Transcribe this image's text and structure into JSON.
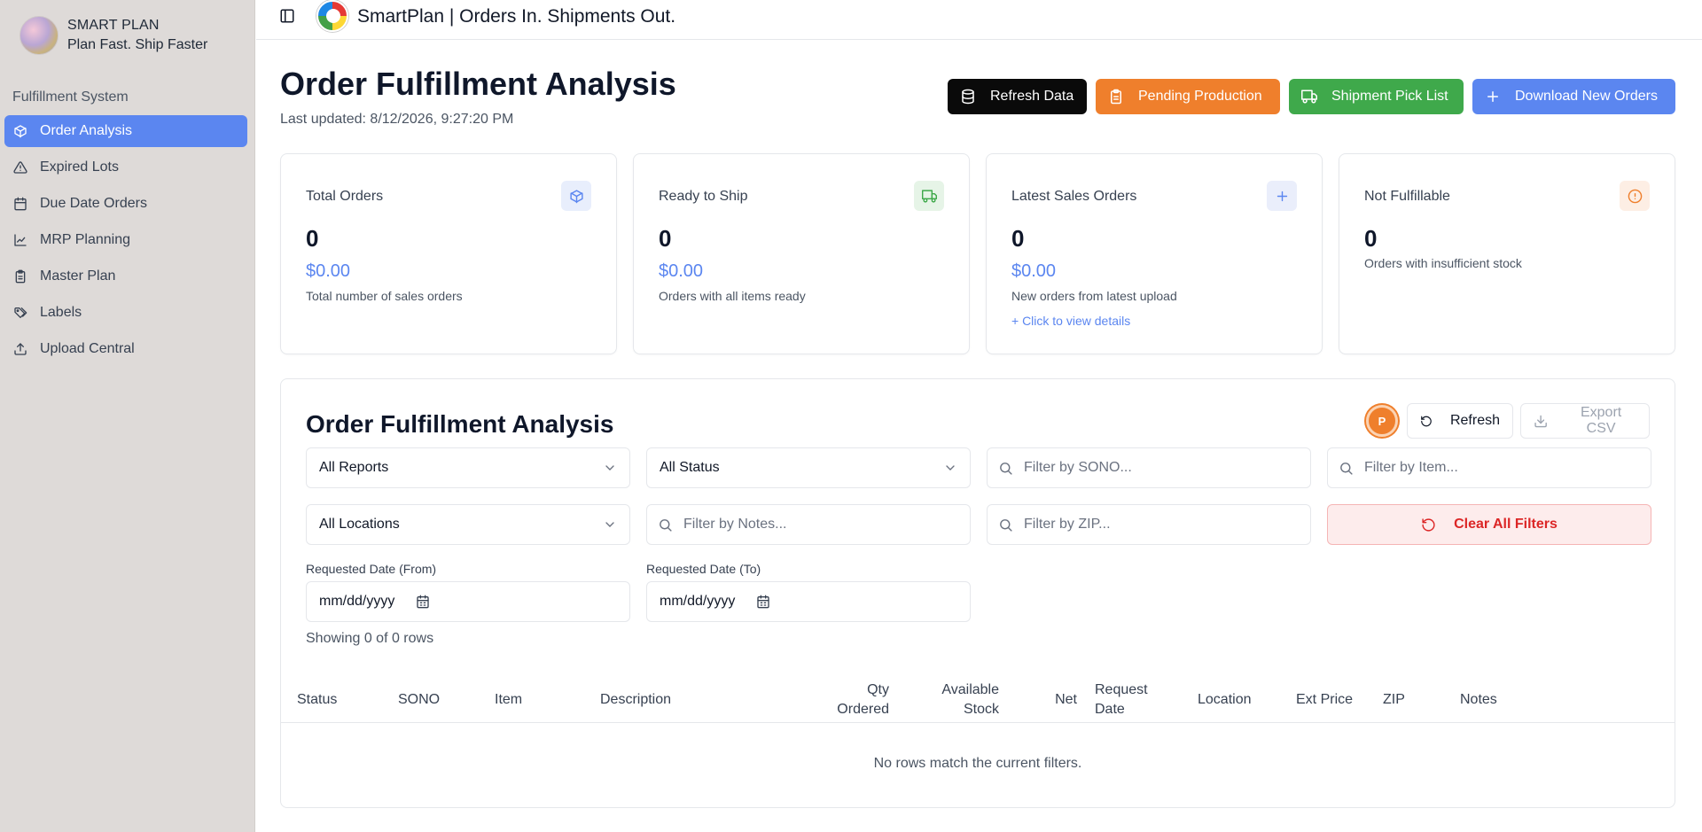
{
  "sidebar": {
    "brand_name": "SMART PLAN",
    "brand_tagline": "Plan Fast. Ship Faster",
    "section_label": "Fulfillment System",
    "items": [
      {
        "label": "Order Analysis",
        "icon": "cube-icon",
        "active": true
      },
      {
        "label": "Expired Lots",
        "icon": "warning-triangle-icon",
        "active": false
      },
      {
        "label": "Due Date Orders",
        "icon": "calendar-icon",
        "active": false
      },
      {
        "label": "MRP Planning",
        "icon": "chart-icon",
        "active": false
      },
      {
        "label": "Master Plan",
        "icon": "clipboard-icon",
        "active": false
      },
      {
        "label": "Labels",
        "icon": "tags-icon",
        "active": false
      },
      {
        "label": "Upload Central",
        "icon": "upload-icon",
        "active": false
      }
    ]
  },
  "topbar": {
    "title": "SmartPlan | Orders In. Shipments Out."
  },
  "header": {
    "title": "Order Fulfillment Analysis",
    "last_updated": "Last updated: 8/12/2026, 9:27:20 PM",
    "buttons": {
      "refresh": "Refresh Data",
      "pending": "Pending Production",
      "picklist": "Shipment Pick List",
      "download": "Download New Orders"
    }
  },
  "cards": {
    "total": {
      "title": "Total Orders",
      "value": "0",
      "amount": "$0.00",
      "desc": "Total number of sales orders"
    },
    "ready": {
      "title": "Ready to Ship",
      "value": "0",
      "amount": "$0.00",
      "desc": "Orders with all items ready"
    },
    "latest": {
      "title": "Latest Sales Orders",
      "value": "0",
      "amount": "$0.00",
      "desc": "New orders from latest upload",
      "link": "+ Click to view details"
    },
    "notfulfill": {
      "title": "Not Fulfillable",
      "value": "0",
      "desc": "Orders with insufficient stock"
    }
  },
  "panel": {
    "title": "Order Fulfillment Analysis",
    "avatar_letter": "P",
    "refresh_label": "Refresh",
    "export_label": "Export CSV",
    "filters": {
      "reports": "All Reports",
      "status": "All Status",
      "sono_placeholder": "Filter by SONO...",
      "item_placeholder": "Filter by Item...",
      "locations": "All Locations",
      "notes_placeholder": "Filter by Notes...",
      "zip_placeholder": "Filter by ZIP...",
      "clear_label": "Clear All Filters"
    },
    "dates": {
      "from_label": "Requested Date (From)",
      "to_label": "Requested Date (To)",
      "from_value": "mm/dd/yyyy",
      "to_value": "mm/dd/yyyy"
    },
    "showing": "Showing 0 of 0 rows",
    "columns": {
      "status": "Status",
      "sono": "SONO",
      "item": "Item",
      "description": "Description",
      "qty_1": "Qty",
      "qty_2": "Ordered",
      "avail_1": "Available",
      "avail_2": "Stock",
      "net": "Net",
      "req_1": "Request",
      "req_2": "Date",
      "location": "Location",
      "ext_price": "Ext Price",
      "zip": "ZIP",
      "notes": "Notes"
    },
    "empty_message": "No rows match the current filters."
  },
  "colors": {
    "accent_blue": "#5b86f0",
    "orange": "#ef7f2c",
    "green": "#3fa94b",
    "danger": "#dc2626"
  }
}
